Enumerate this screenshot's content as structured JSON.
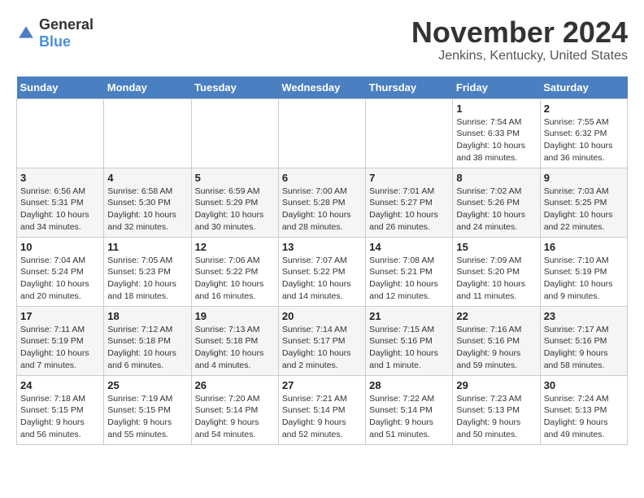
{
  "logo": {
    "general": "General",
    "blue": "Blue",
    "icon": "▶"
  },
  "title": "November 2024",
  "subtitle": "Jenkins, Kentucky, United States",
  "days_of_week": [
    "Sunday",
    "Monday",
    "Tuesday",
    "Wednesday",
    "Thursday",
    "Friday",
    "Saturday"
  ],
  "weeks": [
    [
      {
        "day": "",
        "info": ""
      },
      {
        "day": "",
        "info": ""
      },
      {
        "day": "",
        "info": ""
      },
      {
        "day": "",
        "info": ""
      },
      {
        "day": "",
        "info": ""
      },
      {
        "day": "1",
        "info": "Sunrise: 7:54 AM\nSunset: 6:33 PM\nDaylight: 10 hours and 38 minutes."
      },
      {
        "day": "2",
        "info": "Sunrise: 7:55 AM\nSunset: 6:32 PM\nDaylight: 10 hours and 36 minutes."
      }
    ],
    [
      {
        "day": "3",
        "info": "Sunrise: 6:56 AM\nSunset: 5:31 PM\nDaylight: 10 hours and 34 minutes."
      },
      {
        "day": "4",
        "info": "Sunrise: 6:58 AM\nSunset: 5:30 PM\nDaylight: 10 hours and 32 minutes."
      },
      {
        "day": "5",
        "info": "Sunrise: 6:59 AM\nSunset: 5:29 PM\nDaylight: 10 hours and 30 minutes."
      },
      {
        "day": "6",
        "info": "Sunrise: 7:00 AM\nSunset: 5:28 PM\nDaylight: 10 hours and 28 minutes."
      },
      {
        "day": "7",
        "info": "Sunrise: 7:01 AM\nSunset: 5:27 PM\nDaylight: 10 hours and 26 minutes."
      },
      {
        "day": "8",
        "info": "Sunrise: 7:02 AM\nSunset: 5:26 PM\nDaylight: 10 hours and 24 minutes."
      },
      {
        "day": "9",
        "info": "Sunrise: 7:03 AM\nSunset: 5:25 PM\nDaylight: 10 hours and 22 minutes."
      }
    ],
    [
      {
        "day": "10",
        "info": "Sunrise: 7:04 AM\nSunset: 5:24 PM\nDaylight: 10 hours and 20 minutes."
      },
      {
        "day": "11",
        "info": "Sunrise: 7:05 AM\nSunset: 5:23 PM\nDaylight: 10 hours and 18 minutes."
      },
      {
        "day": "12",
        "info": "Sunrise: 7:06 AM\nSunset: 5:22 PM\nDaylight: 10 hours and 16 minutes."
      },
      {
        "day": "13",
        "info": "Sunrise: 7:07 AM\nSunset: 5:22 PM\nDaylight: 10 hours and 14 minutes."
      },
      {
        "day": "14",
        "info": "Sunrise: 7:08 AM\nSunset: 5:21 PM\nDaylight: 10 hours and 12 minutes."
      },
      {
        "day": "15",
        "info": "Sunrise: 7:09 AM\nSunset: 5:20 PM\nDaylight: 10 hours and 11 minutes."
      },
      {
        "day": "16",
        "info": "Sunrise: 7:10 AM\nSunset: 5:19 PM\nDaylight: 10 hours and 9 minutes."
      }
    ],
    [
      {
        "day": "17",
        "info": "Sunrise: 7:11 AM\nSunset: 5:19 PM\nDaylight: 10 hours and 7 minutes."
      },
      {
        "day": "18",
        "info": "Sunrise: 7:12 AM\nSunset: 5:18 PM\nDaylight: 10 hours and 6 minutes."
      },
      {
        "day": "19",
        "info": "Sunrise: 7:13 AM\nSunset: 5:18 PM\nDaylight: 10 hours and 4 minutes."
      },
      {
        "day": "20",
        "info": "Sunrise: 7:14 AM\nSunset: 5:17 PM\nDaylight: 10 hours and 2 minutes."
      },
      {
        "day": "21",
        "info": "Sunrise: 7:15 AM\nSunset: 5:16 PM\nDaylight: 10 hours and 1 minute."
      },
      {
        "day": "22",
        "info": "Sunrise: 7:16 AM\nSunset: 5:16 PM\nDaylight: 9 hours and 59 minutes."
      },
      {
        "day": "23",
        "info": "Sunrise: 7:17 AM\nSunset: 5:16 PM\nDaylight: 9 hours and 58 minutes."
      }
    ],
    [
      {
        "day": "24",
        "info": "Sunrise: 7:18 AM\nSunset: 5:15 PM\nDaylight: 9 hours and 56 minutes."
      },
      {
        "day": "25",
        "info": "Sunrise: 7:19 AM\nSunset: 5:15 PM\nDaylight: 9 hours and 55 minutes."
      },
      {
        "day": "26",
        "info": "Sunrise: 7:20 AM\nSunset: 5:14 PM\nDaylight: 9 hours and 54 minutes."
      },
      {
        "day": "27",
        "info": "Sunrise: 7:21 AM\nSunset: 5:14 PM\nDaylight: 9 hours and 52 minutes."
      },
      {
        "day": "28",
        "info": "Sunrise: 7:22 AM\nSunset: 5:14 PM\nDaylight: 9 hours and 51 minutes."
      },
      {
        "day": "29",
        "info": "Sunrise: 7:23 AM\nSunset: 5:13 PM\nDaylight: 9 hours and 50 minutes."
      },
      {
        "day": "30",
        "info": "Sunrise: 7:24 AM\nSunset: 5:13 PM\nDaylight: 9 hours and 49 minutes."
      }
    ]
  ]
}
